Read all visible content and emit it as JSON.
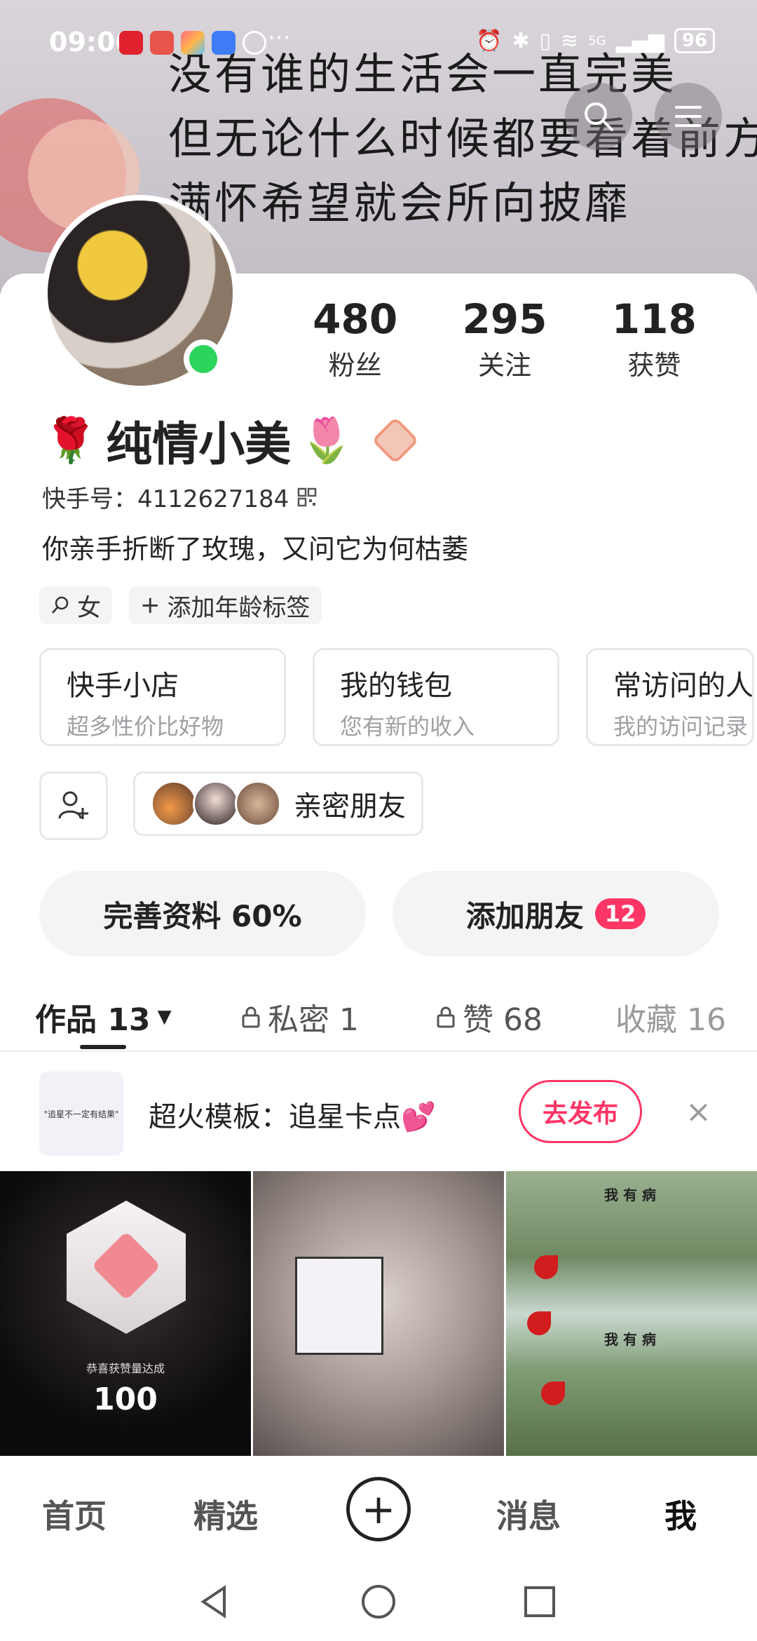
{
  "status_bar": {
    "time": "09:00",
    "more": "···",
    "battery": "96",
    "network": "5G"
  },
  "banner": {
    "handwriting_lines": [
      "没有谁的生活会一直完美",
      "但无论什么时候都要看着前方",
      "满怀希望就会所向披靡"
    ]
  },
  "profile": {
    "name": "纯情小美",
    "name_prefix_emoji": "🌹",
    "name_suffix_emoji": "🌷",
    "kuaishou_id": "快手号：4112627184",
    "bio": "你亲手折断了玫瑰，又问它为何枯萎",
    "online": true
  },
  "stats": [
    {
      "value": "480",
      "label": "粉丝"
    },
    {
      "value": "295",
      "label": "关注"
    },
    {
      "value": "118",
      "label": "获赞"
    }
  ],
  "tags": [
    {
      "icon": "female-icon",
      "label": "女"
    },
    {
      "icon": "plus-icon",
      "label": "添加年龄标签"
    }
  ],
  "service_cards": [
    {
      "title": "快手小店",
      "subtitle": "超多性价比好物"
    },
    {
      "title": "我的钱包",
      "subtitle": "您有新的收入"
    },
    {
      "title": "常访问的人",
      "subtitle": "我的访问记录"
    }
  ],
  "close_friends_label": "亲密朋友",
  "actions": {
    "complete_profile": "完善资料 60%",
    "add_friends": "添加朋友",
    "add_friends_badge": "12"
  },
  "tabs": {
    "works": "作品 13",
    "private": "私密 1",
    "likes": "赞 68",
    "favorites": "收藏 16"
  },
  "promo": {
    "thumb_text": "\"追星不一定有结果\"",
    "text": "超火模板：追星卡点💕",
    "button": "去发布",
    "close": "×"
  },
  "grid": {
    "tile1_caption": "恭喜获赞量达成",
    "tile1_number": "100",
    "tile3_text": "我 有 病"
  },
  "bottom_nav": {
    "home": "首页",
    "featured": "精选",
    "plus": "+",
    "messages": "消息",
    "me": "我"
  },
  "colors": {
    "accent": "#fe3666",
    "online": "#2bd45b"
  }
}
